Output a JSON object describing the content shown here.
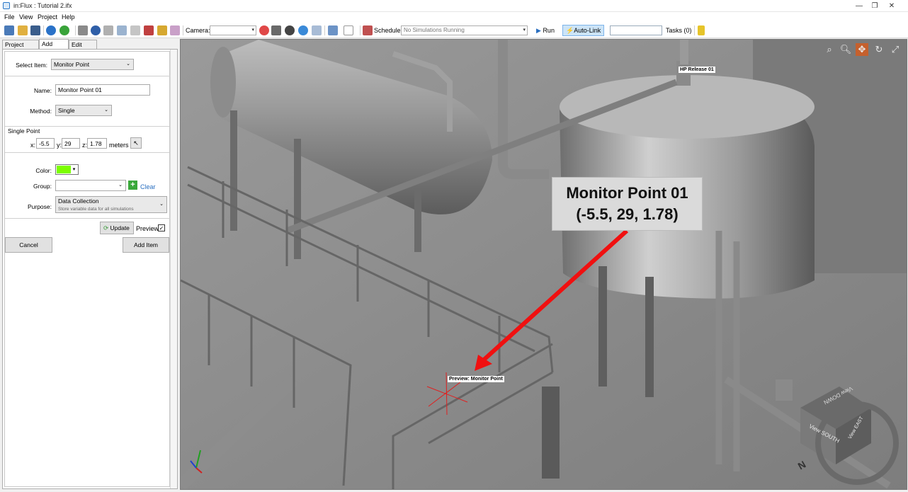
{
  "window": {
    "title": "in:Flux : Tutorial 2.ifx",
    "controls": [
      "—",
      "❐",
      "✕"
    ]
  },
  "menu": [
    "File",
    "View",
    "Project",
    "Help"
  ],
  "toolbar": {
    "camera_label": "Camera:",
    "camera_value": "",
    "schedule_label": "Schedule:",
    "schedule_value": "No Simulations Running",
    "run_label": "Run",
    "autolink_label": "Auto-Link",
    "tasks_label": "Tasks (0)"
  },
  "tabs": [
    "Project Items",
    "Add Item",
    "Edit Item"
  ],
  "form": {
    "select_item_label": "Select Item:",
    "select_item_value": "Monitor Point",
    "name_label": "Name:",
    "name_value": "Monitor Point 01",
    "method_label": "Method:",
    "method_value": "Single",
    "single_point_heading": "Single Point",
    "x_label": "x:",
    "x_value": "-5.5",
    "y_label": "y:",
    "y_value": "29",
    "z_label": "z:",
    "z_value": "1.78",
    "units": "meters",
    "color_label": "Color:",
    "color_value": "#7cfc00",
    "group_label": "Group:",
    "group_value": "",
    "clear_label": "Clear",
    "purpose_label": "Purpose:",
    "purpose_value": "Data Collection",
    "purpose_desc": "Store variable data for all simulations",
    "update_label": "Update",
    "preview_label": "Preview",
    "preview_checked": true,
    "cancel_label": "Cancel",
    "add_label": "Add Item"
  },
  "viewport": {
    "callout_line1": "Monitor Point 01",
    "callout_line2": "(-5.5, 29, 1.78)",
    "release_tag": "HP Release 01",
    "preview_tag": "Preview: Monitor Point",
    "cube_top": "View DOWN",
    "cube_south": "View SOUTH",
    "cube_east": "View EAST",
    "compass_n": "N"
  }
}
